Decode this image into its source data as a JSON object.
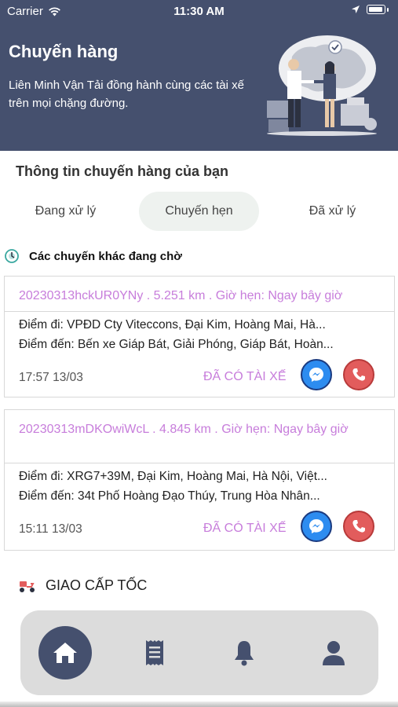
{
  "status_bar": {
    "carrier": "Carrier",
    "time": "11:30 AM"
  },
  "header": {
    "title": "Chuyến hàng",
    "subtitle": "Liên Minh Vận Tải đồng hành cùng các tài xế trên mọi chặng đường."
  },
  "section_title": "Thông tin chuyến hàng của bạn",
  "tabs": [
    {
      "label": "Đang xử lý"
    },
    {
      "label": "Chuyến hẹn"
    },
    {
      "label": "Đã xử lý"
    }
  ],
  "active_tab": "Chuyến hẹn",
  "waiting_label": "Các chuyến khác đang chờ",
  "trips": [
    {
      "header": "20230313hckUR0YNy . 5.251 km . Giờ hẹn: Ngay bây giờ",
      "from": "Điểm đi: VPĐD Cty Viteccons, Đại Kim, Hoàng Mai, Hà...",
      "to": "Điểm đến: Bến xe Giáp Bát, Giải Phóng, Giáp Bát, Hoàn...",
      "time": "17:57 13/03",
      "status": "ĐÃ CÓ TÀI XẾ"
    },
    {
      "header": "20230313mDKOwiWcL . 4.845 km . Giờ hẹn: Ngay bây giờ",
      "from": "Điểm đi: XRG7+39M, Đại Kim, Hoàng Mai, Hà Nội, Việt...",
      "to": "Điểm đến: 34t Phố Hoàng Đạo Thúy, Trung Hòa Nhân...",
      "time": "15:11 13/03",
      "status": "ĐÃ CÓ TÀI XẾ"
    }
  ],
  "express_label": "GIAO CẤP TỐC",
  "nav": {
    "items": [
      {
        "icon": "home-icon",
        "active": true
      },
      {
        "icon": "receipt-icon",
        "active": false
      },
      {
        "icon": "bell-icon",
        "active": false
      },
      {
        "icon": "user-icon",
        "active": false
      }
    ]
  },
  "colors": {
    "header_bg": "#45506e",
    "accent_purple": "#c77ddb",
    "messenger_blue": "#2d8cf0",
    "call_red": "#e25c5c"
  }
}
